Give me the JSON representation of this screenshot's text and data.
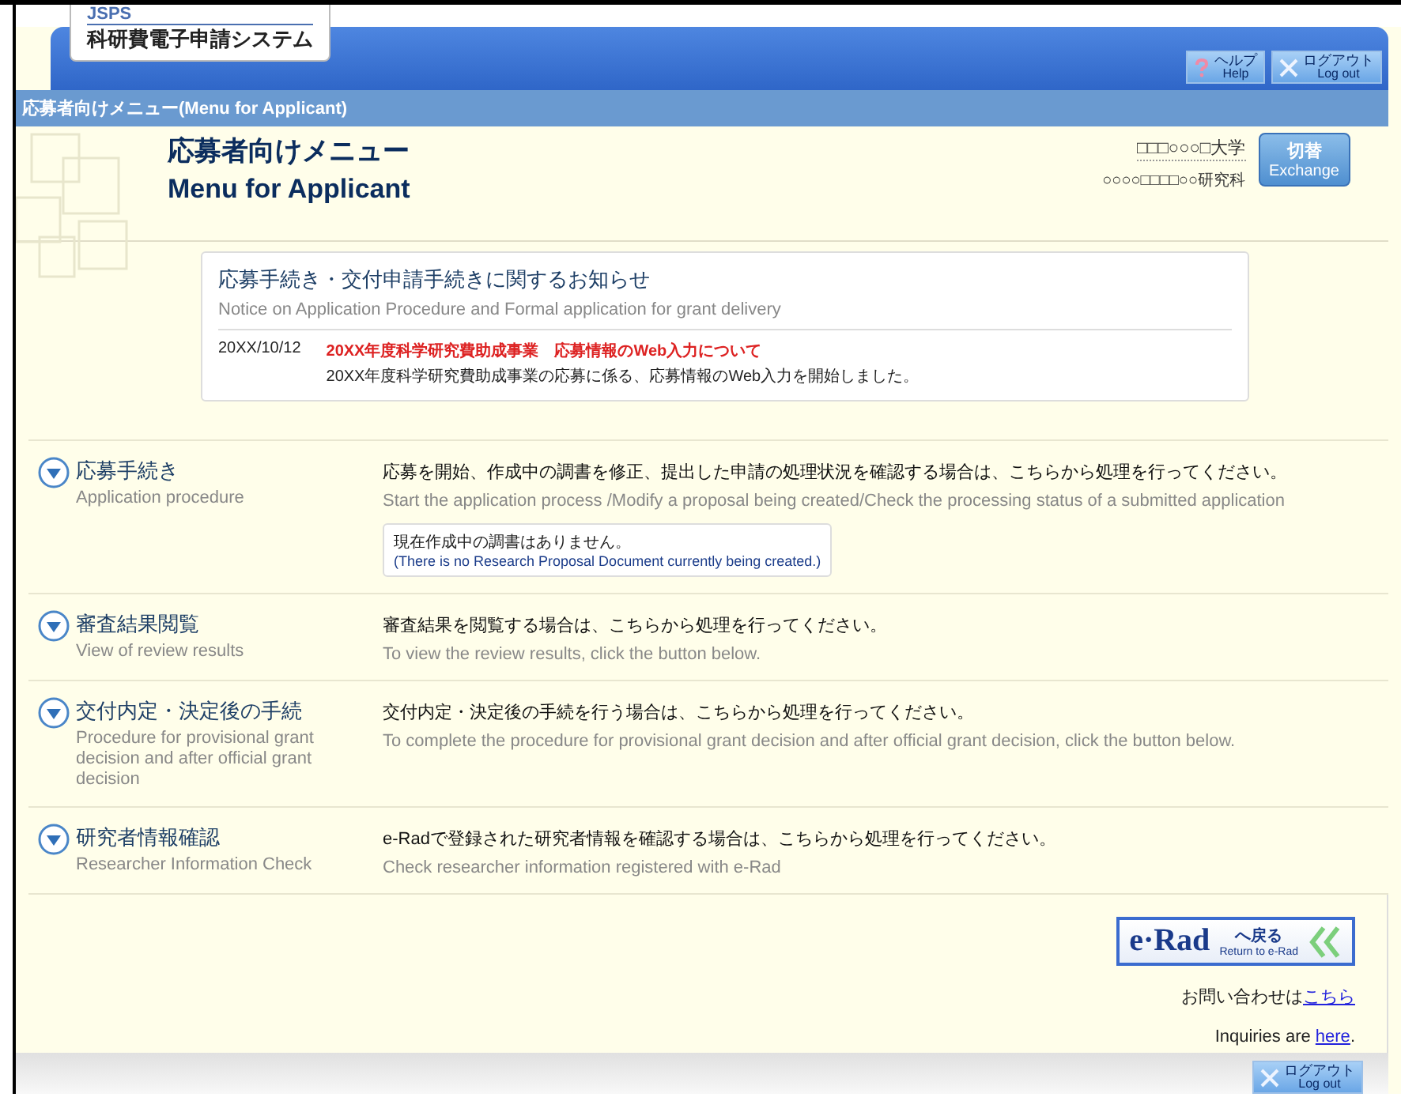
{
  "header": {
    "logo_small": "JSPS",
    "logo_title": "科研費電子申請システム",
    "buttons": [
      {
        "kind": "help",
        "ja": "ヘルプ",
        "en": "Help"
      },
      {
        "kind": "logout",
        "ja": "ログアウト",
        "en": "Log out"
      }
    ]
  },
  "breadcrumb": "応募者向けメニュー(Menu for Applicant)",
  "title": {
    "ja": "応募者向けメニュー",
    "en": "Menu for Applicant"
  },
  "affiliation": {
    "university": "□□□○○○□大学",
    "department": "○○○○□□□□○○研究科"
  },
  "exchange_button": {
    "ja": "切替",
    "en": "Exchange"
  },
  "notice": {
    "title": "応募手続き・交付申請手続きに関するお知らせ",
    "subtitle": "Notice on Application Procedure and Formal application for grant delivery",
    "items": [
      {
        "date": "20XX/10/12",
        "headline": "20XX年度科学研究費助成事業　応募情報のWeb入力について",
        "body": "20XX年度科学研究費助成事業の応募に係る、応募情報のWeb入力を開始しました。"
      }
    ]
  },
  "sections": [
    {
      "ja": "応募手続き",
      "en": "Application procedure",
      "desc_ja": "応募を開始、作成中の調書を修正、提出した申請の処理状況を確認する場合は、こちらから処理を行ってください。",
      "desc_en": "Start the application process /Modify a proposal being created/Check the processing status of a submitted application",
      "status": {
        "ja": "現在作成中の調書はありません。",
        "en": "(There is no Research Proposal Document currently being created.)"
      }
    },
    {
      "ja": "審査結果閲覧",
      "en": "View of review results",
      "desc_ja": "審査結果を閲覧する場合は、こちらから処理を行ってください。",
      "desc_en": "To view the review results, click the button below."
    },
    {
      "ja": "交付内定・決定後の手続",
      "en": "Procedure for provisional grant decision and after official grant decision",
      "desc_ja": "交付内定・決定後の手続を行う場合は、こちらから処理を行ってください。",
      "desc_en": "To complete the procedure for provisional grant decision and after official grant decision, click the button below."
    },
    {
      "ja": "研究者情報確認",
      "en": "Researcher Information Check",
      "desc_ja": "e-Radで登録された研究者情報を確認する場合は、こちらから処理を行ってください。",
      "desc_en": "Check researcher information registered with e-Rad"
    }
  ],
  "erad_button": {
    "logo": "e·Rad",
    "ja": "へ戻る",
    "en": "Return to e-Rad"
  },
  "inquiry": [
    {
      "text": "お問い合わせは",
      "link": "こちら"
    },
    {
      "text": "Inquiries are ",
      "link": "here",
      "after": "."
    }
  ],
  "footer_button": {
    "ja": "ログアウト",
    "en": "Log out"
  }
}
